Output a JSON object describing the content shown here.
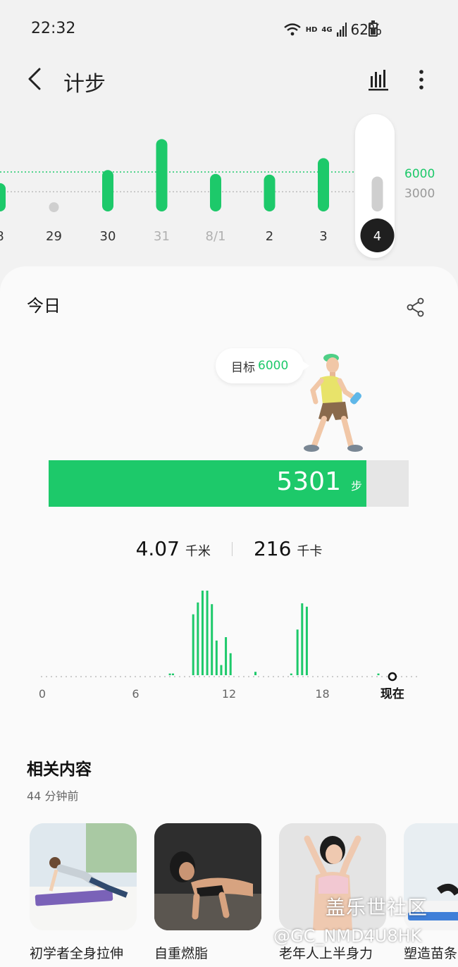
{
  "status": {
    "time": "22:32",
    "hd": "HD",
    "network": "4G",
    "battery": "62%"
  },
  "app_bar": {
    "title": "计步"
  },
  "weekly_chart": {
    "days": [
      "8",
      "29",
      "30",
      "31",
      "8/1",
      "2",
      "3",
      "4"
    ],
    "selected_index": 7,
    "dim_indices": [
      3,
      4
    ],
    "goal_label": "6000",
    "mid_label": "3000",
    "goal_value": 6000,
    "mid_value": 3000,
    "values": [
      4300,
      200,
      6300,
      11000,
      5700,
      5600,
      8100,
      5301
    ]
  },
  "today": {
    "title": "今日",
    "goal_prefix": "目标",
    "goal_value": "6000",
    "steps": "5301",
    "steps_unit": "步",
    "progress_fraction": 0.883,
    "distance": "4.07",
    "distance_unit": "千米",
    "calories": "216",
    "calories_unit": "千卡"
  },
  "hourly_chart": {
    "x_ticks": [
      "0",
      "6",
      "12",
      "18"
    ],
    "now_label": "现在",
    "bars": [
      {
        "hour": 8.2,
        "value": 2
      },
      {
        "hour": 8.4,
        "value": 2
      },
      {
        "hour": 9.7,
        "value": 72
      },
      {
        "hour": 10.0,
        "value": 86
      },
      {
        "hour": 10.3,
        "value": 100
      },
      {
        "hour": 10.6,
        "value": 100
      },
      {
        "hour": 10.9,
        "value": 84
      },
      {
        "hour": 11.2,
        "value": 41
      },
      {
        "hour": 11.5,
        "value": 12
      },
      {
        "hour": 11.8,
        "value": 45
      },
      {
        "hour": 12.1,
        "value": 26
      },
      {
        "hour": 13.7,
        "value": 4
      },
      {
        "hour": 16.0,
        "value": 2
      },
      {
        "hour": 16.4,
        "value": 54
      },
      {
        "hour": 16.7,
        "value": 85
      },
      {
        "hour": 17.0,
        "value": 81
      },
      {
        "hour": 21.6,
        "value": 2
      }
    ]
  },
  "related": {
    "title": "相关内容",
    "time": "44 分钟前",
    "items": [
      {
        "label": "初学者全身拉伸"
      },
      {
        "label": "自重燃脂"
      },
      {
        "label": "老年人上半身力"
      },
      {
        "label": "塑造苗条"
      }
    ]
  },
  "watermark": {
    "line1": "盖乐世社区",
    "line2": "@GC_NMD4U8HK"
  },
  "colors": {
    "accent": "#1dc96a",
    "dim_bar": "#cfcfcf",
    "background": "#f2f2f2",
    "card": "#fafafa"
  }
}
